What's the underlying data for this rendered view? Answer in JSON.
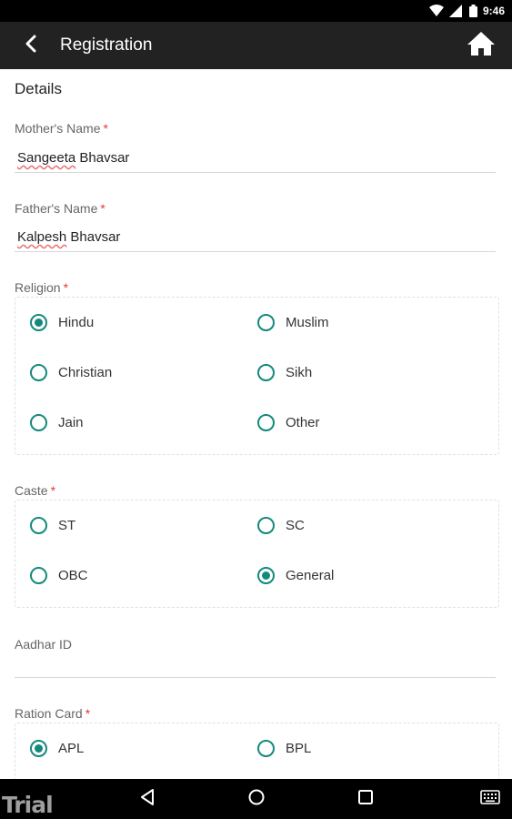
{
  "status_bar": {
    "time": "9:46",
    "icons": [
      "wifi-icon",
      "signal-icon",
      "battery-icon"
    ]
  },
  "app_bar": {
    "title": "Registration",
    "back_icon": "back-arrow-icon",
    "home_icon": "home-icon"
  },
  "form": {
    "section_title": "Details",
    "mothers_name": {
      "label": "Mother's Name",
      "required_mark": "*",
      "value": "Sangeeta Bhavsar",
      "value_first": "Sangeeta",
      "value_rest": " Bhavsar"
    },
    "fathers_name": {
      "label": "Father's Name",
      "required_mark": "*",
      "value": "Kalpesh Bhavsar",
      "value_first": "Kalpesh",
      "value_rest": " Bhavsar"
    },
    "religion": {
      "label": "Religion",
      "required_mark": "*",
      "options": [
        "Hindu",
        "Muslim",
        "Christian",
        "Sikh",
        "Jain",
        "Other"
      ],
      "selected": "Hindu"
    },
    "caste": {
      "label": "Caste",
      "required_mark": "*",
      "options": [
        "ST",
        "SC",
        "OBC",
        "General"
      ],
      "selected": "General"
    },
    "aadhar_id": {
      "label": "Aadhar ID",
      "value": ""
    },
    "ration_card": {
      "label": "Ration Card",
      "required_mark": "*",
      "options": [
        "APL",
        "BPL"
      ],
      "selected": "APL"
    }
  },
  "nav_bar": {
    "watermark": "Trial",
    "buttons": [
      "back-triangle-icon",
      "home-circle-icon",
      "recents-square-icon",
      "keyboard-icon"
    ]
  },
  "colors": {
    "accent": "#13897b",
    "app_bar": "#222222",
    "required": "#e53935"
  }
}
